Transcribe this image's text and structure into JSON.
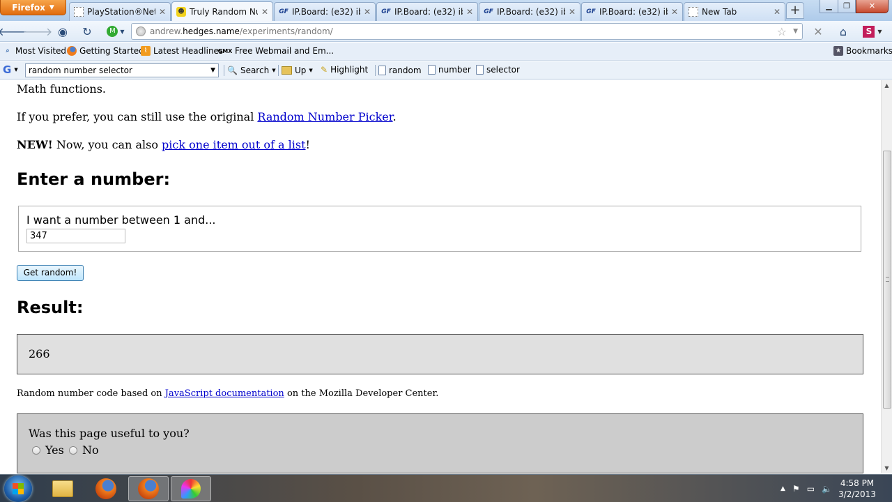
{
  "browser": {
    "app_button": "Firefox",
    "tabs": [
      {
        "title": "PlayStation®Net...",
        "favicon": "blank-page-icon"
      },
      {
        "title": "Truly Random Nu...",
        "favicon": "site-icon"
      },
      {
        "title": "IP.Board: (e32) ib...",
        "favicon": "gf-icon"
      },
      {
        "title": "IP.Board: (e32) ib...",
        "favicon": "gf-icon"
      },
      {
        "title": "IP.Board: (e32) ib...",
        "favicon": "gf-icon"
      },
      {
        "title": "IP.Board: (e32) ib...",
        "favicon": "gf-icon"
      },
      {
        "title": "New Tab",
        "favicon": "blank-page-icon"
      }
    ],
    "active_tab": 1,
    "url": {
      "prefix": "andrew.",
      "host": "hedges.name",
      "path": "/experiments/random/"
    },
    "bookmarks": [
      "Most Visited",
      "Getting Started",
      "Latest Headlines",
      "Free Webmail and Em...",
      "Bookmarks"
    ],
    "google_toolbar": {
      "search_value": "random number selector",
      "search_label": "Search",
      "up_label": "Up",
      "highlight_label": "Highlight",
      "terms": [
        "random",
        "number",
        "selector"
      ]
    }
  },
  "page": {
    "intro_tail": "Math functions.",
    "prefer_text": "If you prefer, you can still use the original",
    "prefer_link": "Random Number Picker",
    "prefer_end": ".",
    "new_bold": "NEW!",
    "new_text": " Now, you can also ",
    "new_link": "pick one item out of a list",
    "new_end": "!",
    "enter_heading": "Enter a number:",
    "range_label": "I want a number between 1 and...",
    "number_value": "347",
    "button_label": "Get random!",
    "result_heading": "Result:",
    "result_value": "266",
    "credit_text": "Random number code based on",
    "credit_link": "JavaScript documentation",
    "credit_end": "on the Mozilla Developer Center.",
    "feedback_question": "Was this page useful to you?",
    "feedback_yes": "Yes",
    "feedback_no": "No"
  },
  "taskbar": {
    "time": "4:58 PM",
    "date": "3/2/2013"
  }
}
